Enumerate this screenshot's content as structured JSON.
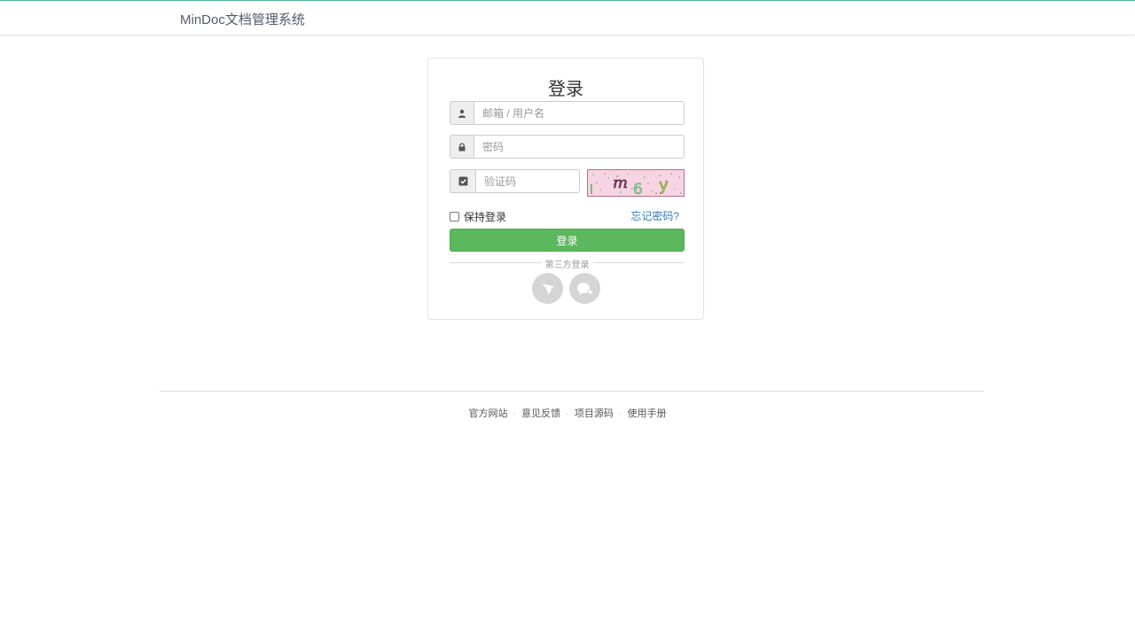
{
  "brand": "MinDoc文档管理系统",
  "login": {
    "title": "登录",
    "account_placeholder": "邮箱 / 用户名",
    "password_placeholder": "密码",
    "captcha_placeholder": "验证码",
    "captcha_chars": [
      "m",
      "6",
      "y"
    ],
    "remember_label": "保持登录",
    "forgot_label": "忘记密码?",
    "submit_label": "登录",
    "third_party_label": "第三方登录",
    "social": [
      {
        "icon": "dingtalk-icon"
      },
      {
        "icon": "wechat-work-icon"
      }
    ]
  },
  "footer": {
    "links": [
      "官方网站",
      "意见反馈",
      "项目源码",
      "使用手册"
    ],
    "separator": "·"
  },
  "colors": {
    "accent": "#44b78b",
    "primary_button": "#5cb85c",
    "link": "#337ab7"
  }
}
